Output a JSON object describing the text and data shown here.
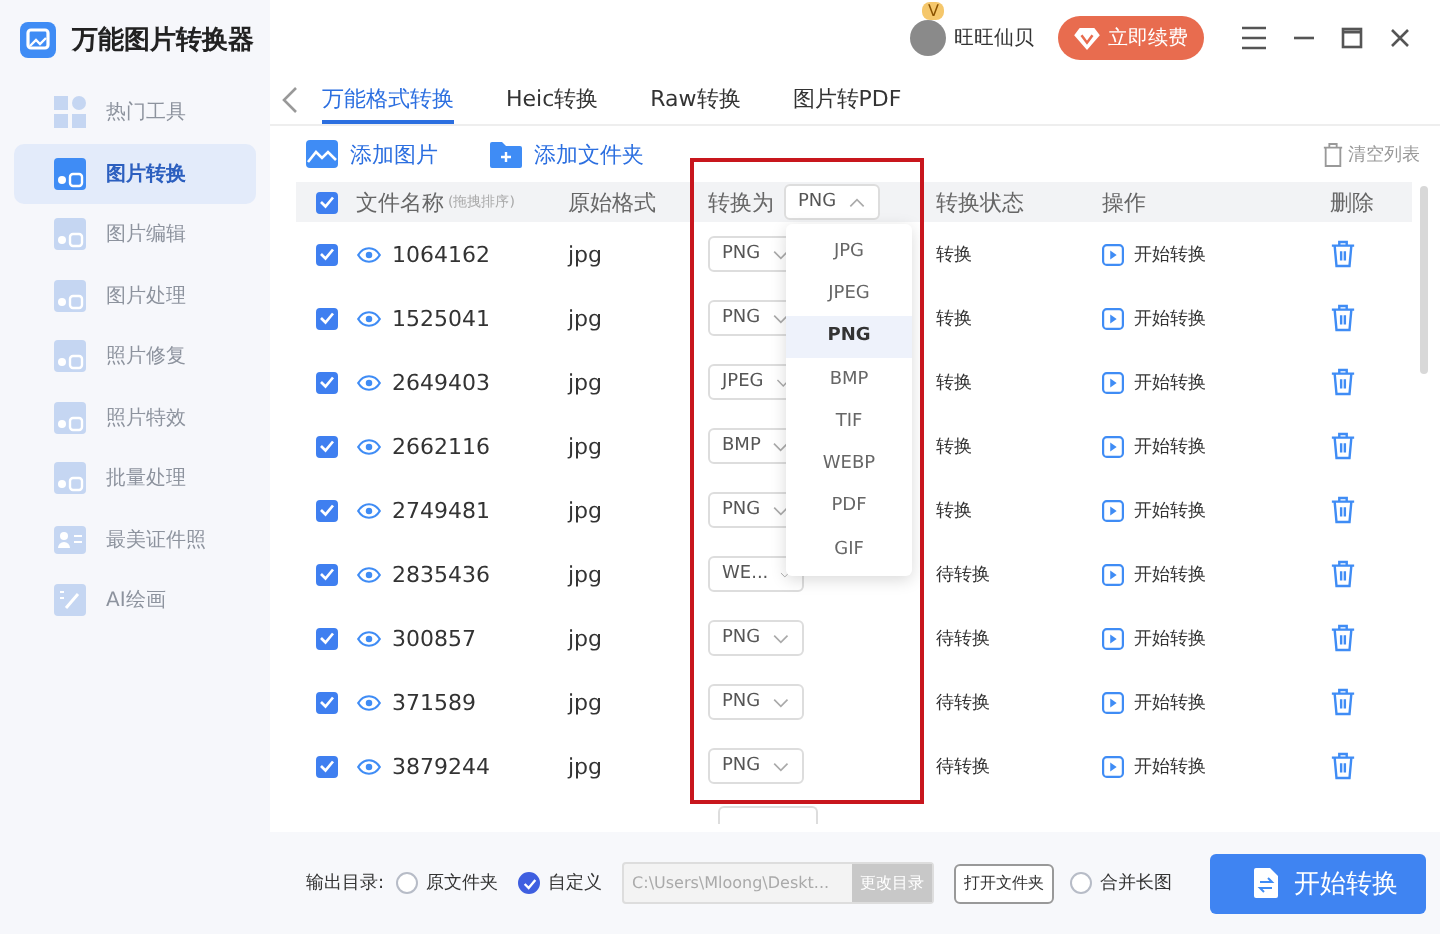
{
  "app": {
    "title": "万能图片转换器"
  },
  "user": {
    "name": "旺旺仙贝",
    "badge": "V"
  },
  "renew_button": "立即续费",
  "sidebar": {
    "items": [
      {
        "label": "热门工具",
        "selected": false,
        "kind": "grid"
      },
      {
        "label": "图片转换",
        "selected": true,
        "kind": "photo"
      },
      {
        "label": "图片编辑",
        "selected": false,
        "kind": "photo"
      },
      {
        "label": "图片处理",
        "selected": false,
        "kind": "photo"
      },
      {
        "label": "照片修复",
        "selected": false,
        "kind": "photo"
      },
      {
        "label": "照片特效",
        "selected": false,
        "kind": "photo"
      },
      {
        "label": "批量处理",
        "selected": false,
        "kind": "photo"
      },
      {
        "label": "最美证件照",
        "selected": false,
        "kind": "idcard"
      },
      {
        "label": "AI绘画",
        "selected": false,
        "kind": "canvas"
      }
    ]
  },
  "tabs": [
    {
      "label": "万能格式转换",
      "selected": true
    },
    {
      "label": "Heic转换",
      "selected": false
    },
    {
      "label": "Raw转换",
      "selected": false
    },
    {
      "label": "图片转PDF",
      "selected": false
    }
  ],
  "toolbar": {
    "add_image": "添加图片",
    "add_folder": "添加文件夹",
    "clear_list": "清空列表"
  },
  "table": {
    "all_checked": true,
    "columns": [
      "文件名称",
      "原始格式",
      "转换为",
      "转换状态",
      "操作",
      "删除"
    ],
    "name_hint": "(拖拽排序)",
    "target_format": "PNG",
    "rows": [
      {
        "checked": true,
        "name": "1064162",
        "format": "jpg",
        "target": "PNG",
        "status": "转换",
        "action": "开始转换"
      },
      {
        "checked": true,
        "name": "1525041",
        "format": "jpg",
        "target": "PNG",
        "status": "转换",
        "action": "开始转换"
      },
      {
        "checked": true,
        "name": "2649403",
        "format": "jpg",
        "target": "JPEG",
        "status": "转换",
        "action": "开始转换"
      },
      {
        "checked": true,
        "name": "2662116",
        "format": "jpg",
        "target": "BMP",
        "status": "转换",
        "action": "开始转换"
      },
      {
        "checked": true,
        "name": "2749481",
        "format": "jpg",
        "target": "PNG",
        "status": "转换",
        "action": "开始转换"
      },
      {
        "checked": true,
        "name": "2835436",
        "format": "jpg",
        "target": "WE...",
        "status": "待转换",
        "action": "开始转换"
      },
      {
        "checked": true,
        "name": "300857",
        "format": "jpg",
        "target": "PNG",
        "status": "待转换",
        "action": "开始转换"
      },
      {
        "checked": true,
        "name": "371589",
        "format": "jpg",
        "target": "PNG",
        "status": "待转换",
        "action": "开始转换"
      },
      {
        "checked": true,
        "name": "3879244",
        "format": "jpg",
        "target": "PNG",
        "status": "待转换",
        "action": "开始转换"
      }
    ]
  },
  "dropdown": {
    "options": [
      {
        "label": "JPG",
        "selected": false
      },
      {
        "label": "JPEG",
        "selected": false
      },
      {
        "label": "PNG",
        "selected": true
      },
      {
        "label": "BMP",
        "selected": false
      },
      {
        "label": "TIF",
        "selected": false
      },
      {
        "label": "WEBP",
        "selected": false
      },
      {
        "label": "PDF",
        "selected": false
      },
      {
        "label": "GIF",
        "selected": false
      }
    ]
  },
  "output": {
    "label": "输出目录:",
    "options": [
      {
        "label": "原文件夹",
        "selected": false
      },
      {
        "label": "自定义",
        "selected": true
      }
    ],
    "path": "C:\\Users\\Mloong\\Deskt...",
    "change_button": "更改目录",
    "open_button": "打开文件夹",
    "merge": {
      "label": "合并长图",
      "checked": false
    },
    "start_button": "开始转换"
  }
}
